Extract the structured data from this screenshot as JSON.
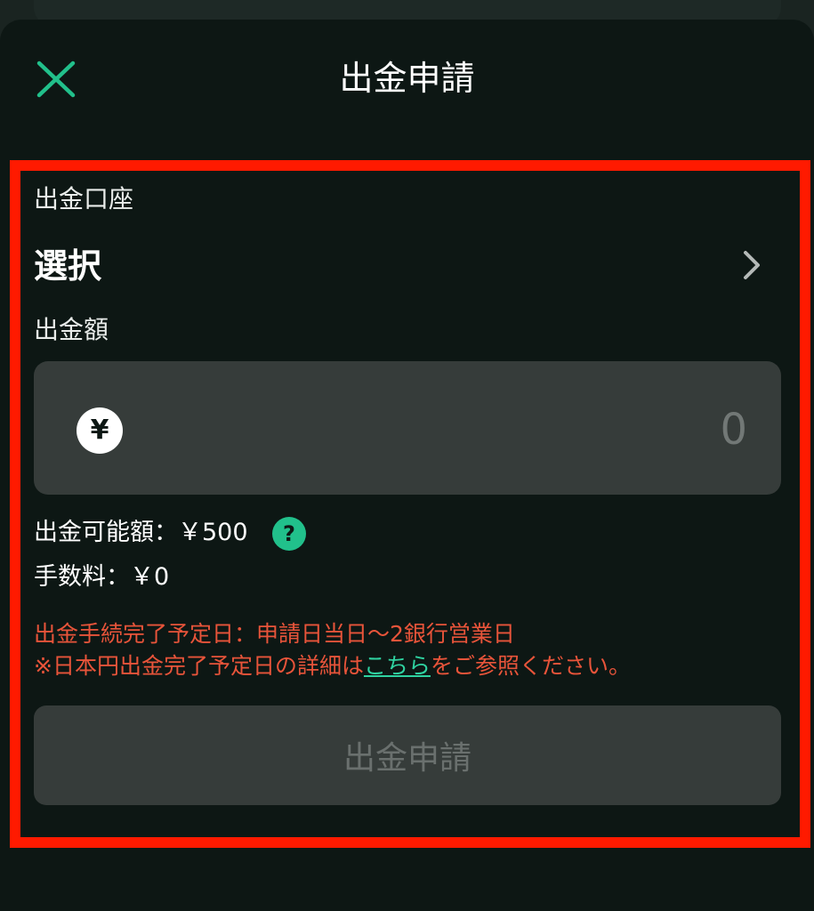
{
  "header": {
    "title": "出金申請",
    "close_icon": "close-icon"
  },
  "colors": {
    "accent": "#21c08b",
    "highlight_border": "#ff1a00",
    "notice_text": "#e8543a",
    "sheet_background": "#0d1714",
    "field_background": "#363c3a"
  },
  "account": {
    "label": "出金口座",
    "value": "選択",
    "chevron_icon": "chevron-right-icon"
  },
  "amount": {
    "label": "出金額",
    "currency_symbol": "¥",
    "placeholder": "0"
  },
  "info": {
    "available": "出金可能額：￥500",
    "help_symbol": "?",
    "fee": "手数料：￥0"
  },
  "notice": {
    "line1": "出金手続完了予定日：申請日当日〜2銀行営業日",
    "line2_prefix": "※日本円出金完了予定日の詳細は",
    "link_text": "こちら",
    "line2_suffix": "をご参照ください。"
  },
  "submit": {
    "label": "出金申請"
  }
}
